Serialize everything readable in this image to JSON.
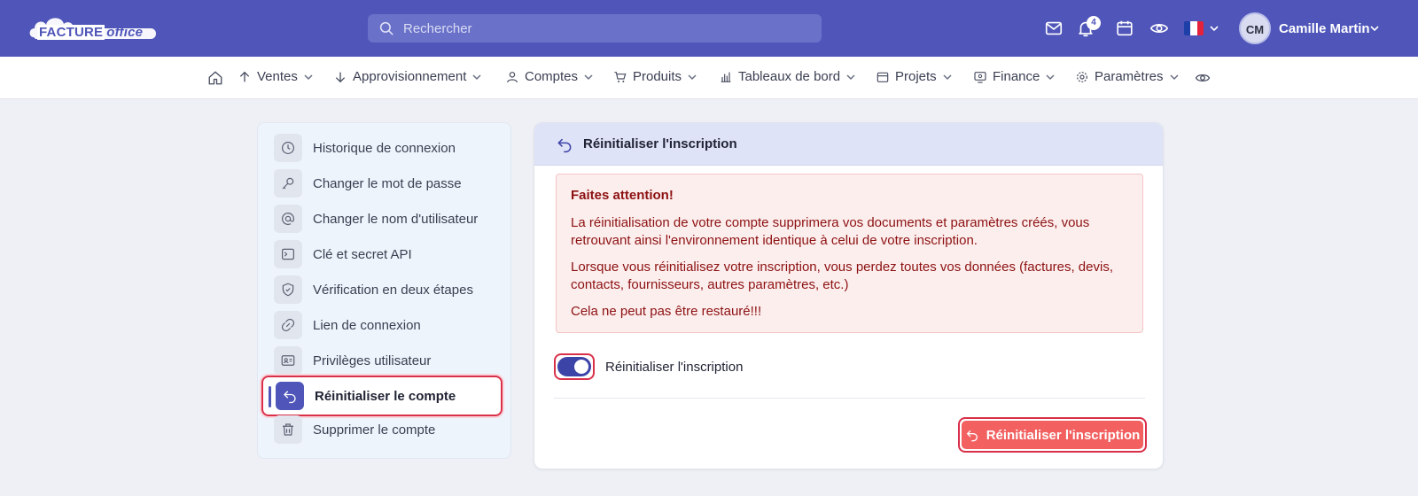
{
  "brand": {
    "logo_word1": "FACTURE",
    "logo_word2": "office"
  },
  "search": {
    "placeholder": "Rechercher"
  },
  "header": {
    "notifications_count": "4",
    "user_initials": "CM",
    "user_name": "Camille Martin",
    "language": "fr"
  },
  "nav": {
    "items": [
      {
        "label": "Ventes"
      },
      {
        "label": "Approvisionnement"
      },
      {
        "label": "Comptes"
      },
      {
        "label": "Produits"
      },
      {
        "label": "Tableaux de bord"
      },
      {
        "label": "Projets"
      },
      {
        "label": "Finance"
      },
      {
        "label": "Paramètres"
      }
    ]
  },
  "sidebar": {
    "items": [
      {
        "label": "Historique de connexion",
        "icon": "clock-icon"
      },
      {
        "label": "Changer le mot de passe",
        "icon": "key-icon"
      },
      {
        "label": "Changer le nom d'utilisateur",
        "icon": "at-icon"
      },
      {
        "label": "Clé et secret API",
        "icon": "terminal-icon"
      },
      {
        "label": "Vérification en deux étapes",
        "icon": "shield-icon"
      },
      {
        "label": "Lien de connexion",
        "icon": "link-icon"
      },
      {
        "label": "Privilèges utilisateur",
        "icon": "id-card-icon"
      },
      {
        "label": "Réinitialiser le compte",
        "icon": "undo-icon",
        "active": true
      },
      {
        "label": "Supprimer le compte",
        "icon": "trash-icon"
      }
    ]
  },
  "card": {
    "title": "Réinitialiser l'inscription",
    "alert": {
      "title": "Faites attention!",
      "p1": "La réinitialisation de votre compte supprimera vos documents et paramètres créés, vous retrouvant ainsi l'environnement identique à celui de votre inscription.",
      "p2": "Lorsque vous réinitialisez votre inscription, vous perdez toutes vos données (factures, devis, contacts, fournisseurs, autres paramètres, etc.)",
      "p3": "Cela ne peut pas être restauré!!!"
    },
    "toggle_label": "Réinitialiser l'inscription",
    "toggle_on": true,
    "button_label": "Réinitialiser l'inscription"
  },
  "colors": {
    "topbar": "#4f55b9",
    "accent": "#3d44a8",
    "danger_button": "#f26060",
    "alert_bg": "#fdeeee",
    "alert_text": "#8c1111"
  }
}
